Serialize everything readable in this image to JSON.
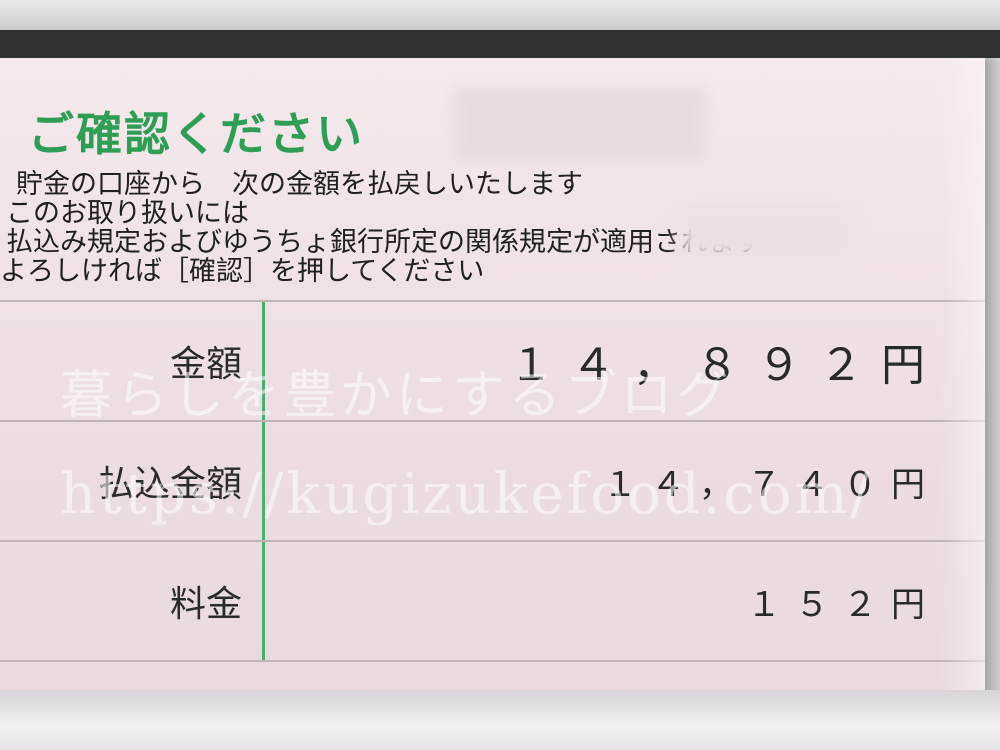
{
  "header": {
    "title": "ご確認ください",
    "title_color": "#2f9e55"
  },
  "message": {
    "lines": [
      "貯金の口座から　次の金額を払戻しいたします",
      "このお取り扱いには",
      "払込み規定およびゆうちょ銀行所定の関係規定が適用されます",
      "よろしければ［確認］を押してください"
    ]
  },
  "details": {
    "rows": [
      {
        "label": "金額",
        "value": "１４，８９２",
        "unit": "円"
      },
      {
        "label": "払込金額",
        "value": "１４，７４０",
        "unit": "円"
      },
      {
        "label": "料金",
        "value": "１５２",
        "unit": "円"
      }
    ]
  },
  "watermark": {
    "line1": "暮らしを豊かにするブログ",
    "line2": "https://kugizukefood.com/"
  },
  "colors": {
    "screen_bg": "#f4e9ec",
    "divider": "#49b06b"
  }
}
